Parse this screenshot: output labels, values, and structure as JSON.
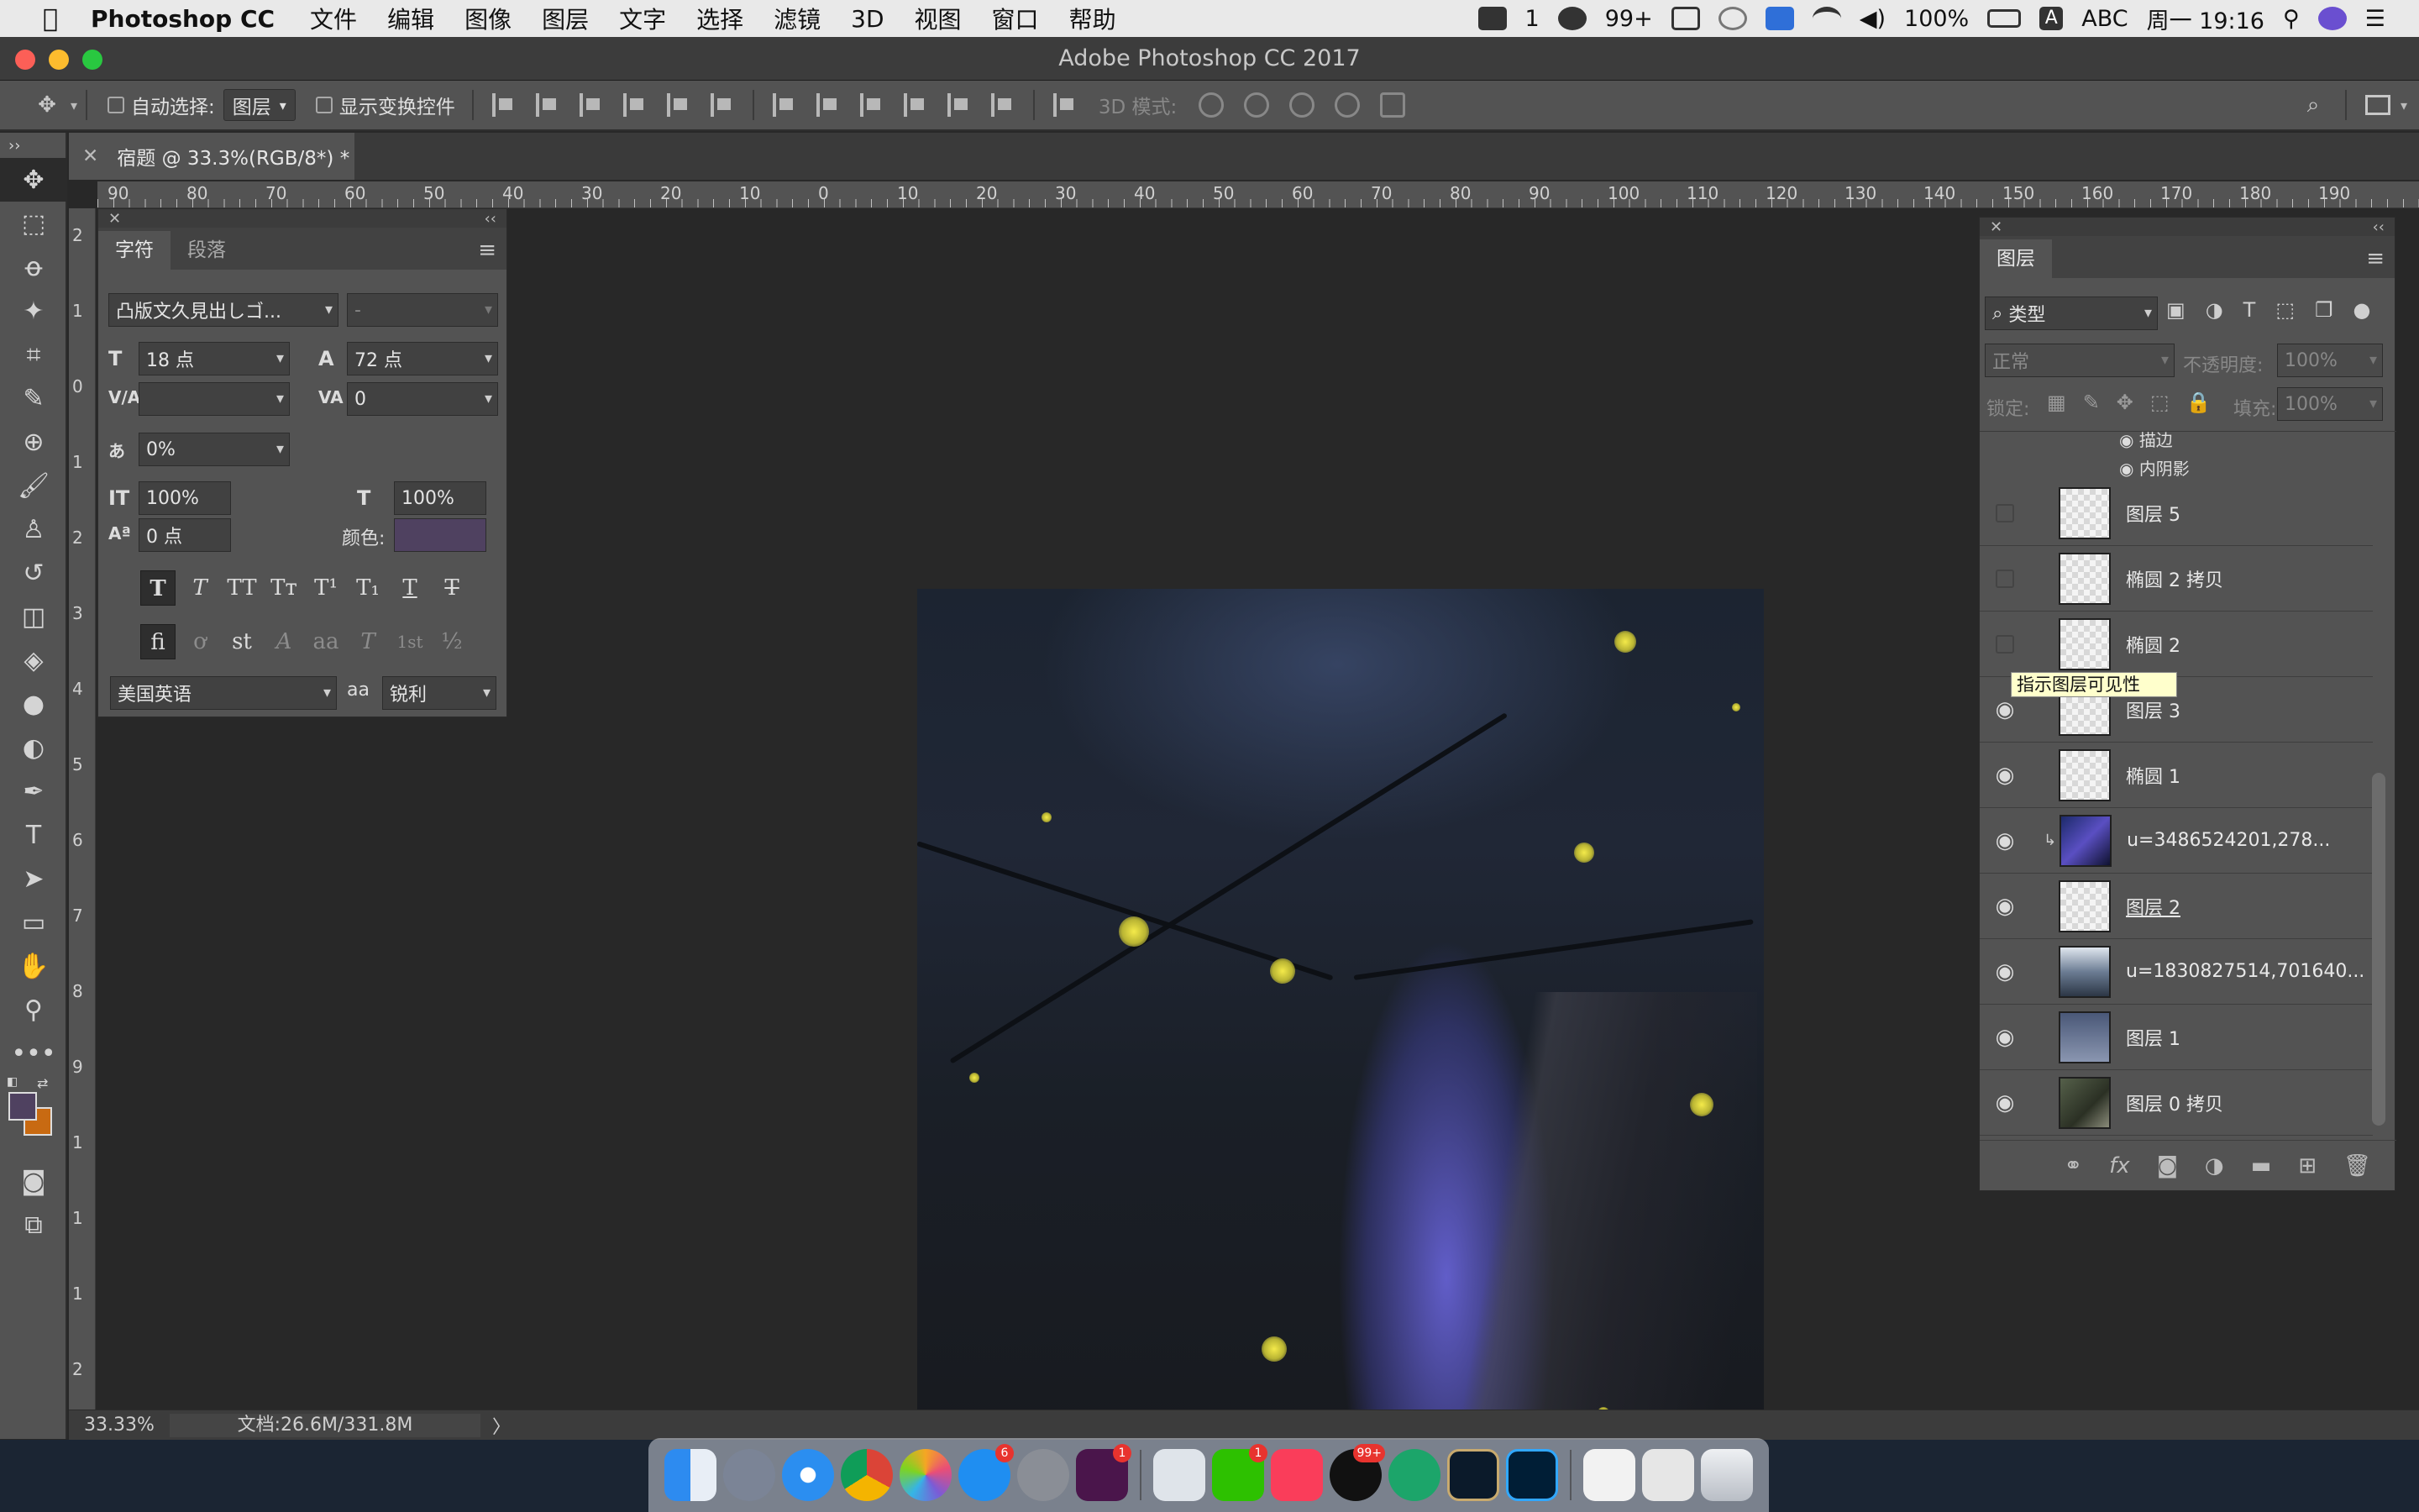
{
  "menubar": {
    "app_name": "Photoshop CC",
    "items": [
      "文件",
      "编辑",
      "图像",
      "图层",
      "文字",
      "选择",
      "滤镜",
      "3D",
      "视图",
      "窗口",
      "帮助"
    ],
    "wechat_count": "1",
    "qq_count": "99+",
    "battery": "100%",
    "input_method": "ABC",
    "clock": "周一 19:16"
  },
  "window": {
    "title": "Adobe Photoshop CC 2017"
  },
  "options_bar": {
    "auto_select_label": "自动选择:",
    "auto_select_value": "图层",
    "show_transform_label": "显示变换控件",
    "mode_3d_label": "3D 模式:"
  },
  "document": {
    "tab_title": "宿题 @ 33.3%(RGB/8*) *",
    "ruler_top_labels": [
      "90",
      "80",
      "70",
      "60",
      "50",
      "40",
      "30",
      "20",
      "10",
      "0",
      "10",
      "20",
      "30",
      "40",
      "50",
      "60",
      "70",
      "80",
      "90",
      "100",
      "110",
      "120",
      "130",
      "140",
      "150",
      "160",
      "170",
      "180",
      "190"
    ],
    "ruler_left_labels": [
      "2",
      "1",
      "0",
      "1",
      "2",
      "3",
      "4",
      "5",
      "6",
      "7",
      "8",
      "9",
      "1",
      "1",
      "1",
      "2"
    ]
  },
  "character_panel": {
    "tabs": [
      "字符",
      "段落"
    ],
    "font_family": "凸版文久見出しゴ...",
    "font_style": "-",
    "font_size": "18 点",
    "leading": "72 点",
    "kerning": "",
    "tracking": "0",
    "tsume": "0%",
    "vertical_scale": "100%",
    "horizontal_scale": "100%",
    "baseline_shift": "0 点",
    "color_label": "颜色:",
    "color": "#4f4160",
    "language": "美国英语",
    "aa_label": "aa",
    "anti_alias": "锐利",
    "style_buttons": [
      "T",
      "T",
      "TT",
      "Tт",
      "T¹",
      "T₁",
      "T",
      "T"
    ],
    "opentype_buttons": [
      "fi",
      "ơ",
      "st",
      "A",
      "aa",
      "T",
      "1st",
      "½"
    ]
  },
  "layers_panel": {
    "title": "图层",
    "filter_label": "类型",
    "blend_mode": "正常",
    "opacity_label": "不透明度:",
    "opacity": "100%",
    "lock_label": "锁定:",
    "fill_label": "填充:",
    "fill": "100%",
    "effects": [
      "描边",
      "内阴影"
    ],
    "layers": [
      {
        "name": "图层 5",
        "visible": false
      },
      {
        "name": "椭圆 2 拷贝",
        "visible": false
      },
      {
        "name": "椭圆 2",
        "visible": false
      },
      {
        "name": "图层 3",
        "visible": true
      },
      {
        "name": "椭圆 1",
        "visible": true
      },
      {
        "name": "u=3486524201,278...",
        "visible": true
      },
      {
        "name": "图层 2",
        "visible": true
      },
      {
        "name": "u=1830827514,701640...",
        "visible": true
      },
      {
        "name": "图层 1",
        "visible": true
      },
      {
        "name": "图层 0 拷贝",
        "visible": true
      }
    ],
    "tooltip": "指示图层可见性"
  },
  "status_bar": {
    "zoom": "33.33%",
    "doc_info": "文档:26.6M/331.8M",
    "arrow": "〉"
  },
  "dock": {
    "app_store_badge": "6",
    "slack_badge": "1",
    "wechat_badge": "1",
    "qq_badge": "99+"
  }
}
